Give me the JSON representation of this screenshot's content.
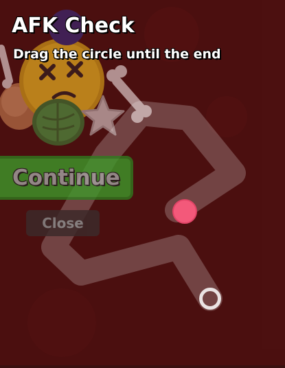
{
  "dialog": {
    "title": "AFK Check",
    "subtitle": "Drag the circle until the end"
  },
  "buttons": {
    "continue_label": "Continue",
    "close_label": "Close"
  },
  "colors": {
    "background": "#3a1010",
    "continue_button": "#3d9b2a",
    "drag_handle": "#f3597a",
    "path": "#ffffff"
  },
  "icons": [
    "dead-face-icon",
    "bone-icon",
    "leaf-icon",
    "star-icon",
    "rock-icon"
  ]
}
